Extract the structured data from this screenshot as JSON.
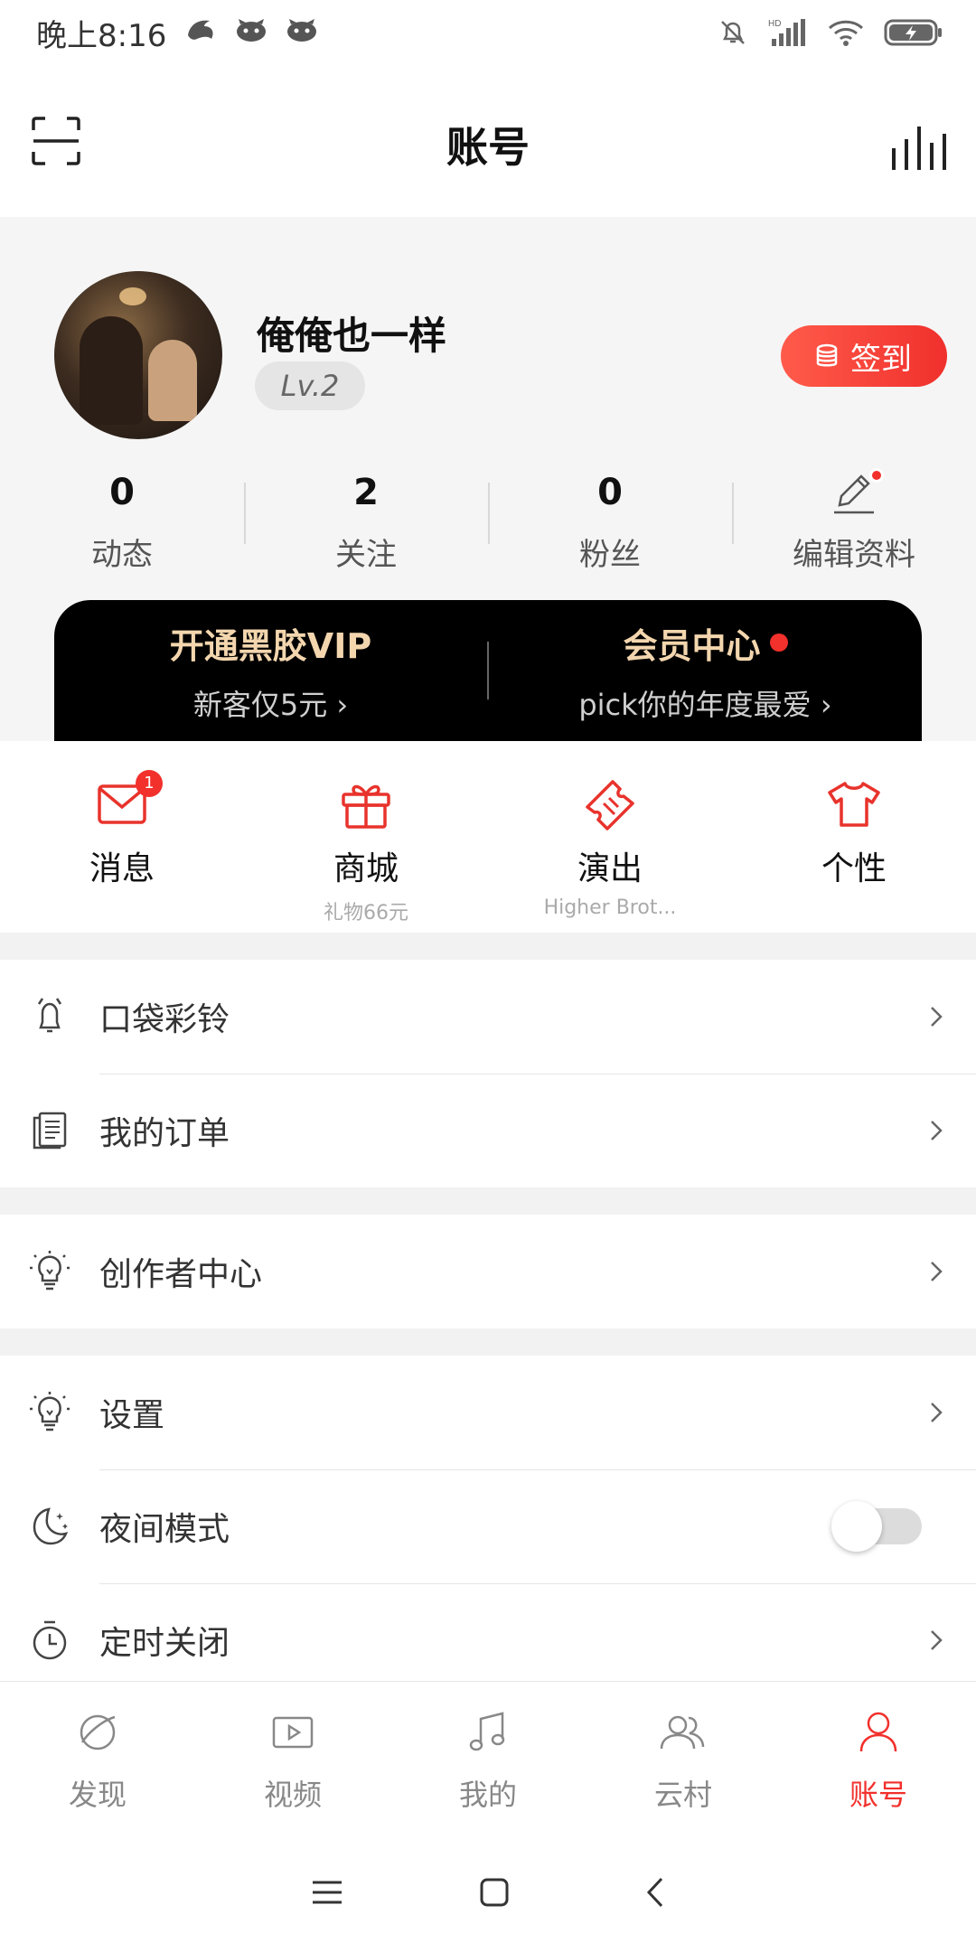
{
  "status_bar": {
    "time": "晚上8:16"
  },
  "header": {
    "title": "账号"
  },
  "profile": {
    "username": "俺俺也一样",
    "level": "Lv.2",
    "signin_label": "签到",
    "stats": [
      {
        "value": "0",
        "label": "动态"
      },
      {
        "value": "2",
        "label": "关注"
      },
      {
        "value": "0",
        "label": "粉丝"
      }
    ],
    "edit_label": "编辑资料"
  },
  "vip": {
    "left_title": "开通黑胶VIP",
    "left_sub": "新客仅5元 ›",
    "right_title": "会员中心",
    "right_sub": "pick你的年度最爱 ›"
  },
  "quick": [
    {
      "label": "消息",
      "sub": "",
      "badge": "1",
      "icon": "mail-icon"
    },
    {
      "label": "商城",
      "sub": "礼物66元",
      "icon": "gift-icon"
    },
    {
      "label": "演出",
      "sub": "Higher Brot...",
      "icon": "ticket-icon"
    },
    {
      "label": "个性",
      "sub": "",
      "icon": "tshirt-icon"
    }
  ],
  "menu": {
    "group1": [
      {
        "label": "口袋彩铃",
        "icon": "bell-icon"
      },
      {
        "label": "我的订单",
        "icon": "order-icon"
      }
    ],
    "group2": [
      {
        "label": "创作者中心",
        "icon": "lightbulb-icon"
      }
    ],
    "group3": [
      {
        "label": "设置",
        "icon": "lightbulb-icon"
      },
      {
        "label": "夜间模式",
        "icon": "moon-icon",
        "toggle": false
      },
      {
        "label": "定时关闭",
        "icon": "timer-icon"
      }
    ]
  },
  "tabs": [
    {
      "label": "发现",
      "icon": "discover-icon"
    },
    {
      "label": "视频",
      "icon": "video-icon"
    },
    {
      "label": "我的",
      "icon": "music-note-icon"
    },
    {
      "label": "云村",
      "icon": "community-icon"
    },
    {
      "label": "账号",
      "icon": "account-icon",
      "active": true
    }
  ],
  "colors": {
    "accent": "#f2302c",
    "vip_gold": "#f3d6ae",
    "background": "#f5f5f5"
  }
}
